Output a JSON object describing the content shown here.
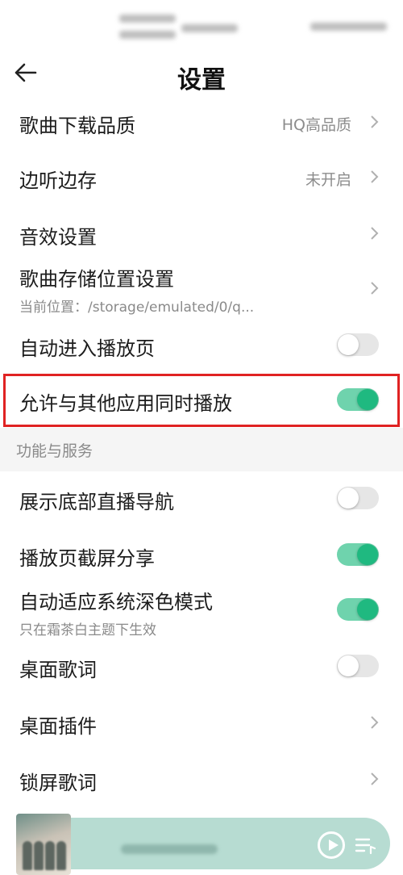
{
  "header": {
    "title": "设置"
  },
  "settings": {
    "download_quality": {
      "label": "歌曲下载品质",
      "value": "HQ高品质"
    },
    "listen_save": {
      "label": "边听边存",
      "value": "未开启"
    },
    "sound_effects": {
      "label": "音效设置"
    },
    "storage_location": {
      "label": "歌曲存储位置设置",
      "sub": "当前位置：/storage/emulated/0/q..."
    },
    "auto_play_page": {
      "label": "自动进入播放页",
      "enabled": false
    },
    "allow_concurrent": {
      "label": "允许与其他应用同时播放",
      "enabled": true
    }
  },
  "section": {
    "title": "功能与服务"
  },
  "services": {
    "live_nav": {
      "label": "展示底部直播导航",
      "enabled": false
    },
    "screenshot_share": {
      "label": "播放页截屏分享",
      "enabled": true
    },
    "dark_mode": {
      "label": "自动适应系统深色模式",
      "sub": "只在霜茶白主题下生效",
      "enabled": true
    },
    "desktop_lyrics": {
      "label": "桌面歌词",
      "enabled": false
    },
    "desktop_widget": {
      "label": "桌面插件"
    },
    "lockscreen_lyrics": {
      "label": "锁屏歌词"
    }
  },
  "colors": {
    "accent": "#1fb980",
    "highlight_border": "#e02222"
  },
  "icons": [
    "back-arrow-icon",
    "chevron-right-icon",
    "play-icon",
    "playlist-icon"
  ]
}
